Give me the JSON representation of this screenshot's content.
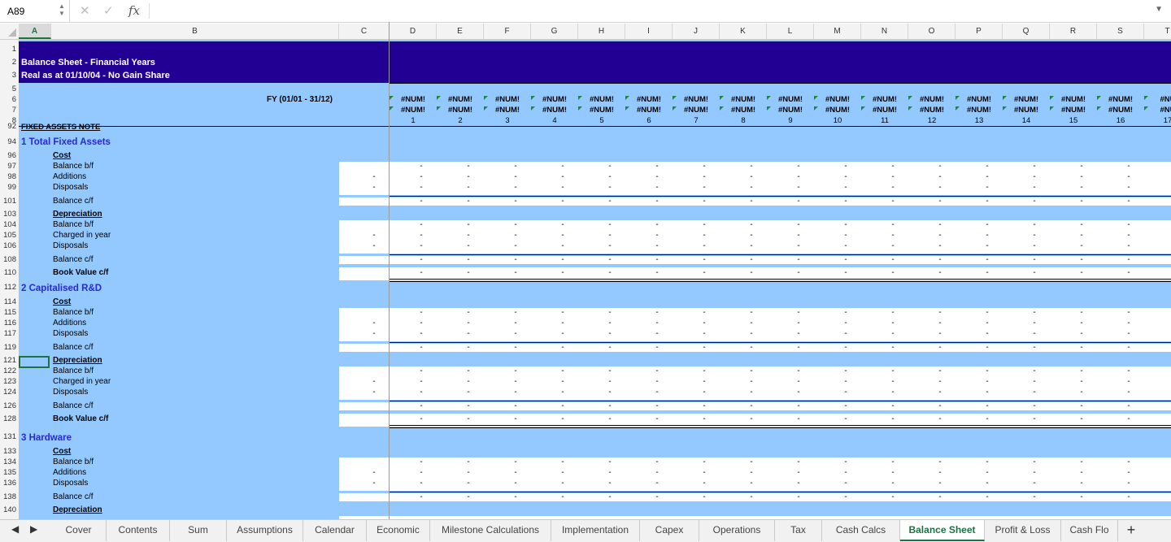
{
  "name_box": "A89",
  "formula_bar": {
    "fx": "fx",
    "value": ""
  },
  "columns": [
    "A",
    "B",
    "C",
    "D",
    "E",
    "F",
    "G",
    "H",
    "I",
    "J",
    "K",
    "L",
    "M",
    "N",
    "O",
    "P",
    "Q",
    "R",
    "S",
    "T"
  ],
  "selected_column": "A",
  "rows": [
    "1",
    "2",
    "3",
    "5",
    "6",
    "7",
    "8",
    "92",
    "94",
    "96",
    "97",
    "98",
    "99",
    "101",
    "103",
    "104",
    "105",
    "106",
    "108",
    "110",
    "112",
    "114",
    "115",
    "116",
    "117",
    "119",
    "121",
    "122",
    "123",
    "124",
    "126",
    "128",
    "131",
    "133",
    "134",
    "135",
    "136",
    "138",
    "140"
  ],
  "header": {
    "title1": "Balance Sheet - Financial Years",
    "title2": "Real as at 01/10/04 - No Gain Share",
    "fy_label": "FY  (01/01 -  31/12)",
    "num_error": "#NUM!",
    "num_error_partial": "#NU",
    "year_numbers": [
      "1",
      "2",
      "3",
      "4",
      "5",
      "6",
      "7",
      "8",
      "9",
      "10",
      "11",
      "12",
      "13",
      "14",
      "15",
      "16",
      "17"
    ]
  },
  "sheet": {
    "fixed_assets_note": "FIXED ASSETS NOTE",
    "sections": [
      {
        "title": "1 Total Fixed Assets",
        "cost": "Cost",
        "balance_bf": "Balance b/f",
        "additions": "Additions",
        "disposals": "Disposals",
        "balance_cf": "Balance c/f",
        "depreciation": "Depreciation",
        "dep_balance_bf": "Balance b/f",
        "charged": "Charged in year",
        "dep_disposals": "Disposals",
        "dep_balance_cf": "Balance c/f",
        "book_value": "Book Value c/f"
      },
      {
        "title": "2 Capitalised R&D",
        "cost": "Cost",
        "balance_bf": "Balance b/f",
        "additions": "Additions",
        "disposals": "Disposals",
        "balance_cf": "Balance c/f",
        "depreciation": "Depreciation",
        "dep_balance_bf": "Balance b/f",
        "charged": "Charged in year",
        "dep_disposals": "Disposals",
        "dep_balance_cf": "Balance c/f",
        "book_value": "Book Value c/f"
      },
      {
        "title": "3 Hardware",
        "cost": "Cost",
        "balance_bf": "Balance b/f",
        "additions": "Additions",
        "disposals": "Disposals",
        "balance_cf": "Balance c/f",
        "depreciation": "Depreciation"
      }
    ],
    "dash": "-"
  },
  "tabs": {
    "items": [
      "Cover",
      "Contents",
      "Sum",
      "Assumptions",
      "Calendar",
      "Economic",
      "Milestone Calculations",
      "Implementation",
      "Capex",
      "Operations",
      "Tax",
      "Cash Calcs",
      "Balance Sheet",
      "Profit & Loss",
      "Cash Flo"
    ],
    "active": "Balance Sheet",
    "add": "+"
  },
  "colors": {
    "navy": "#230094",
    "light_blue": "#93c9ff",
    "section_text": "#2929d6",
    "excel_green": "#1e7145"
  }
}
